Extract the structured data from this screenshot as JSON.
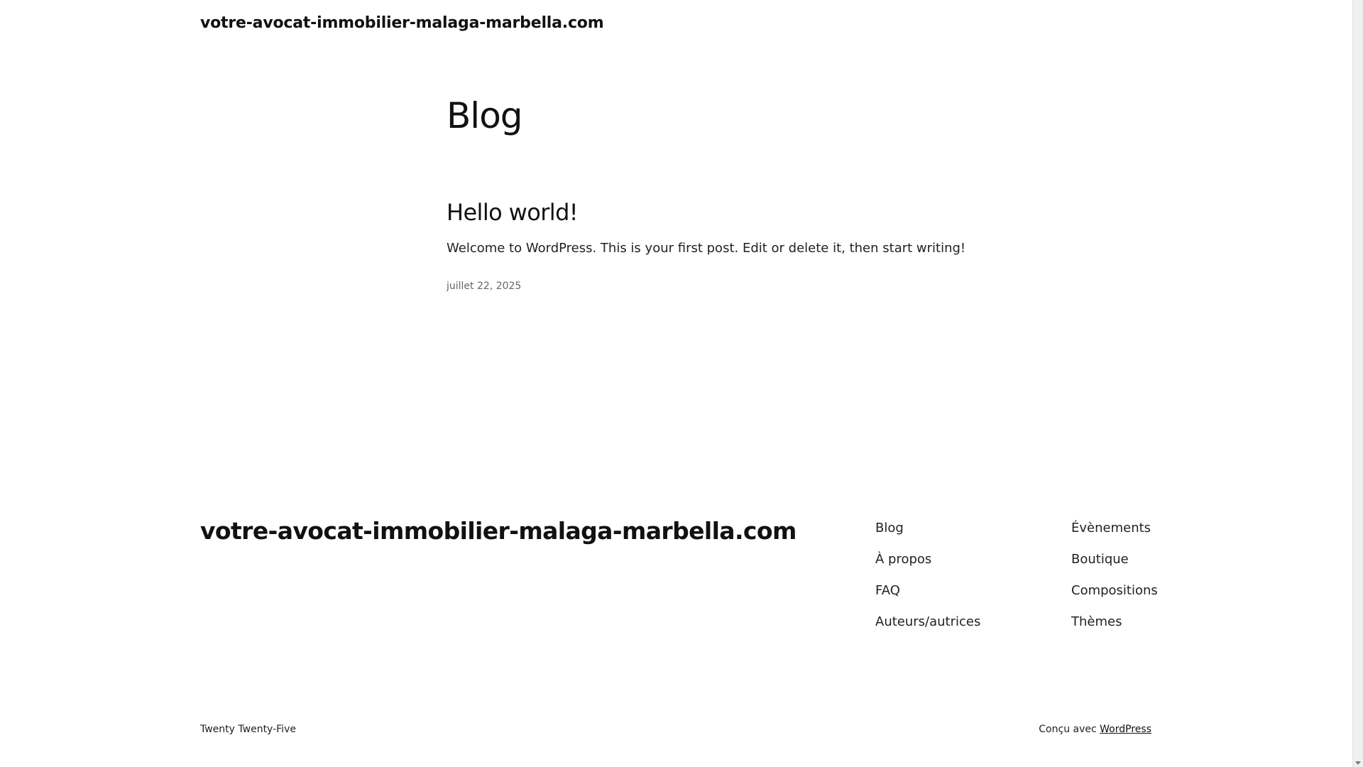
{
  "header": {
    "site_title": "votre-avocat-immobilier-malaga-marbella.com"
  },
  "main": {
    "archive_title": "Blog",
    "post": {
      "title": "Hello world!",
      "excerpt": "Welcome to WordPress. This is your first post. Edit or delete it, then start writing!",
      "date": "juillet 22, 2025"
    }
  },
  "footer": {
    "site_title": "votre-avocat-immobilier-malaga-marbella.com",
    "nav_col1": [
      "Blog",
      "À propos",
      "FAQ",
      "Auteurs/autrices"
    ],
    "nav_col2": [
      "Évènements",
      "Boutique",
      "Compositions",
      "Thèmes"
    ],
    "theme_credit": "Twenty Twenty-Five",
    "powered_by_prefix": "Conçu avec",
    "powered_by_link": "WordPress"
  }
}
